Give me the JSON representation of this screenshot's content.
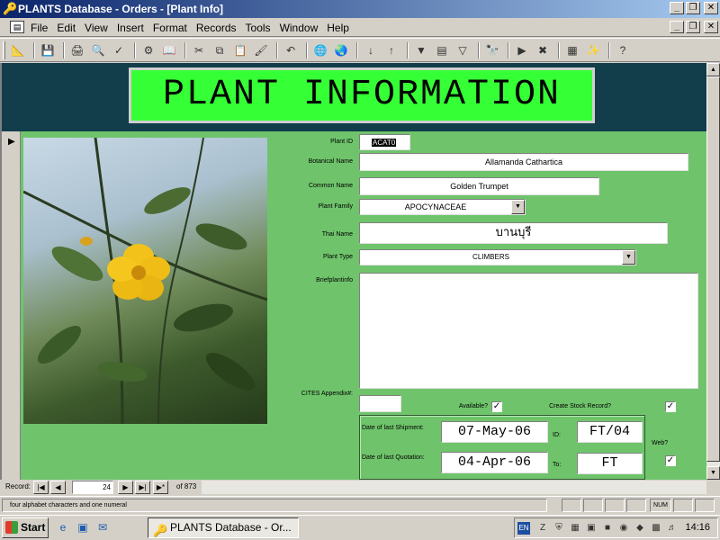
{
  "window": {
    "title": "PLANTS Database - Orders - [Plant Info]"
  },
  "menu": [
    "File",
    "Edit",
    "View",
    "Insert",
    "Format",
    "Records",
    "Tools",
    "Window",
    "Help"
  ],
  "header": {
    "title": "PLANT INFORMATION"
  },
  "fields": {
    "plant_id": {
      "label": "Plant ID",
      "value": "ACAT0"
    },
    "botanical_name": {
      "label": "Botanical Name",
      "value": "Allamanda Cathartica"
    },
    "common_name": {
      "label": "Common Name",
      "value": "Golden Trumpet"
    },
    "plant_family": {
      "label": "Plant Family",
      "value": "APOCYNACEAE"
    },
    "thai_name": {
      "label": "Thai Name",
      "value": "บานบุรี"
    },
    "plant_type": {
      "label": "Plant Type",
      "value": "CLIMBERS"
    },
    "brief_info": {
      "label": "Briefplantinfo",
      "value": ""
    },
    "cites": {
      "label": "CITES Appendix#:",
      "value": ""
    },
    "available": {
      "label": "Available?",
      "checked": true
    },
    "create_stock": {
      "label": "Create Stock Record?",
      "checked": true
    },
    "web": {
      "label": "Web?",
      "checked": true
    },
    "last_shipment": {
      "label": "Date of last Shipment:",
      "value": "07-May-06"
    },
    "shipment_id": {
      "label": "ID:",
      "value": "FT/04"
    },
    "last_quotation": {
      "label": "Date of last Quotation:",
      "value": "04-Apr-06"
    },
    "quotation_to": {
      "label": "To:",
      "value": "FT"
    }
  },
  "navigation": {
    "label": "Record:",
    "current": "24",
    "total": "of 873"
  },
  "status": {
    "text": "four alphabet characters and one numeral",
    "num": "NUM"
  },
  "taskbar": {
    "start": "Start",
    "task": "PLANTS Database - Or...",
    "lang": "EN",
    "clock": "14:16"
  },
  "colors": {
    "form_bg": "#6fc46b",
    "header_band": "#123d4b",
    "header_box": "#35ff35"
  }
}
